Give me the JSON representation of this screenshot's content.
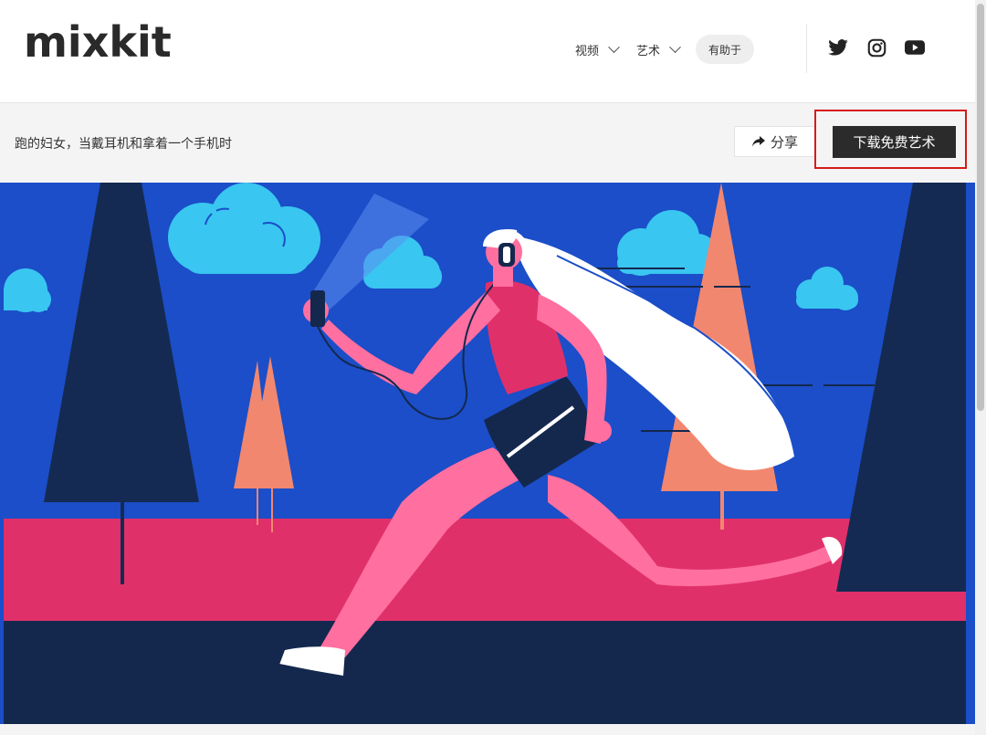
{
  "header": {
    "logo_text": "mixkit",
    "nav": [
      {
        "label": "视频",
        "has_dropdown": true
      },
      {
        "label": "艺术",
        "has_dropdown": true
      },
      {
        "label": "有助于",
        "has_dropdown": false
      }
    ],
    "social_icons": [
      "twitter-icon",
      "instagram-icon",
      "youtube-icon"
    ]
  },
  "asset": {
    "title": "跑的妇女，当戴耳机和拿着一个手机时",
    "share_label": "分享",
    "download_label": "下载免费艺术"
  },
  "colors": {
    "sky": "#1b4ec8",
    "track": "#e0306a",
    "ground": "#14284e",
    "tree_dark": "#152a52",
    "tree_salmon": "#f2876f",
    "cloud": "#39c6f0",
    "skin": "#ff6fa0",
    "highlight_border": "#d61a1a"
  }
}
